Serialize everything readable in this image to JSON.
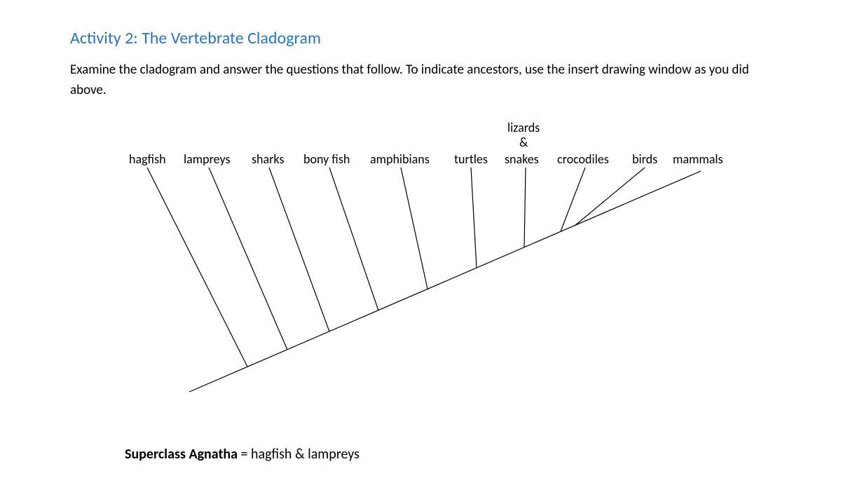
{
  "title": "Activity 2: The Vertebrate Cladogram",
  "instructions": "Examine the cladogram and answer the questions that follow. To indicate ancestors, use the insert drawing window as you did above.",
  "cladogram": {
    "lizards_stack": {
      "line1": "lizards",
      "line2": "&"
    },
    "taxa_row": {
      "hagfish": "hagfish",
      "lampreys": "lampreys",
      "sharks": "sharks",
      "bony_fish": "bony fish",
      "amphibians": "amphibians",
      "turtles": "turtles",
      "snakes": "snakes",
      "crocodiles": "crocodiles",
      "birds": "birds",
      "mammals": "mammals"
    }
  },
  "footer": {
    "bold_label": "Superclass Agnatha",
    "rest": " = hagfish & lampreys"
  },
  "chart_data": {
    "type": "cladogram",
    "title": "The Vertebrate Cladogram",
    "taxa_in_order": [
      "hagfish",
      "lampreys",
      "sharks",
      "bony fish",
      "amphibians",
      "turtles",
      "lizards & snakes",
      "crocodiles",
      "birds",
      "mammals"
    ],
    "backbone_endpoints": {
      "start": "lower-left root",
      "end": "mammals tip (upper-right)"
    },
    "branches_off_backbone_bottom_to_top": [
      "hagfish",
      "lampreys",
      "sharks",
      "bony fish",
      "amphibians",
      "turtles",
      "lizards & snakes",
      "crocodiles",
      "birds"
    ],
    "named_groups": {
      "Superclass Agnatha": [
        "hagfish",
        "lampreys"
      ]
    }
  }
}
